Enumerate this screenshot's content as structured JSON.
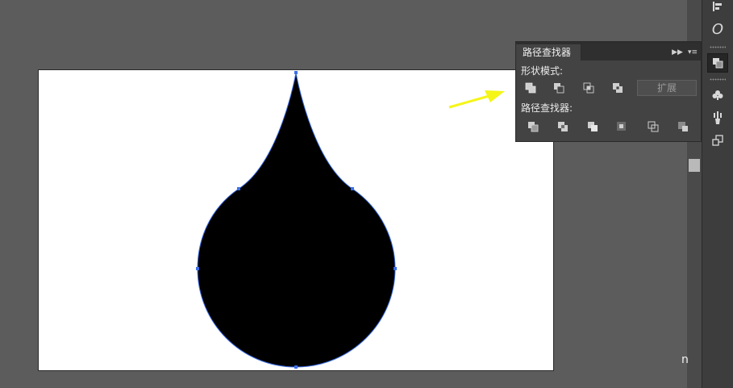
{
  "panel": {
    "tab_title": "路径查找器",
    "shape_modes_label": "形状模式:",
    "pathfinders_label": "路径查找器:",
    "expand_label": "扩展",
    "shape_mode_buttons": [
      "unite-icon",
      "minus-front-icon",
      "intersect-icon",
      "exclude-icon"
    ],
    "pathfinder_buttons": [
      "divide-icon",
      "trim-icon",
      "merge-icon",
      "crop-icon",
      "outline-icon",
      "minus-back-icon"
    ]
  },
  "dock": {
    "items": [
      "align-icon",
      "transparency-icon",
      "pathfinder-icon",
      "symbols-icon",
      "brushes-icon",
      "transform-icon"
    ],
    "transparency_glyph": "O"
  },
  "watermark": {
    "text": "n"
  },
  "colors": {
    "workspace": "#5c5c5c",
    "artboard": "#ffffff",
    "shape_fill": "#000000",
    "selection": "#3d6fe6",
    "arrow": "#f5f518",
    "panel_bg": "#434343"
  }
}
